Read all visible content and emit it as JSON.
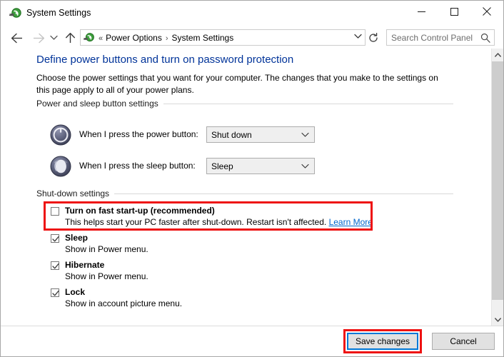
{
  "window": {
    "title": "System Settings",
    "icon": "power-plug-icon",
    "controls": {
      "minimize": "minimize-icon",
      "maximize": "maximize-icon",
      "close": "close-icon"
    }
  },
  "nav": {
    "back": "back-arrow-icon",
    "forward": "forward-arrow-icon",
    "recent": "recent-locations-icon",
    "up": "up-arrow-icon",
    "refresh": "refresh-icon",
    "address_icon": "power-plug-icon",
    "separator": "«",
    "crumb1": "Power Options",
    "crumb2": "System Settings",
    "dropdown": "address-dropdown-icon"
  },
  "search": {
    "placeholder": "Search Control Panel",
    "icon": "search-icon"
  },
  "main": {
    "heading": "Define power buttons and turn on password protection",
    "subtext": "Choose the power settings that you want for your computer. The changes that you make to the settings on this page apply to all of your power plans.",
    "heading_color": "#003399"
  },
  "groups": [
    {
      "label": "Power and sleep button settings",
      "rows": [
        {
          "icon": "power-button-icon",
          "label": "When I press the power button:",
          "value": "Shut down"
        },
        {
          "icon": "sleep-moon-icon",
          "label": "When I press the sleep button:",
          "value": "Sleep"
        }
      ]
    },
    {
      "label": "Shut-down settings",
      "items": [
        {
          "label": "Turn on fast start-up (recommended)",
          "checked": false,
          "desc": "This helps start your PC faster after shut-down. Restart isn't affected. ",
          "link": "Learn More"
        },
        {
          "label": "Sleep",
          "checked": true,
          "desc": "Show in Power menu."
        },
        {
          "label": "Hibernate",
          "checked": true,
          "desc": "Show in Power menu."
        },
        {
          "label": "Lock",
          "checked": true,
          "desc": "Show in account picture menu."
        }
      ]
    }
  ],
  "buttons": {
    "save": "Save changes",
    "cancel": "Cancel"
  },
  "annotation_color": "#ee1111"
}
